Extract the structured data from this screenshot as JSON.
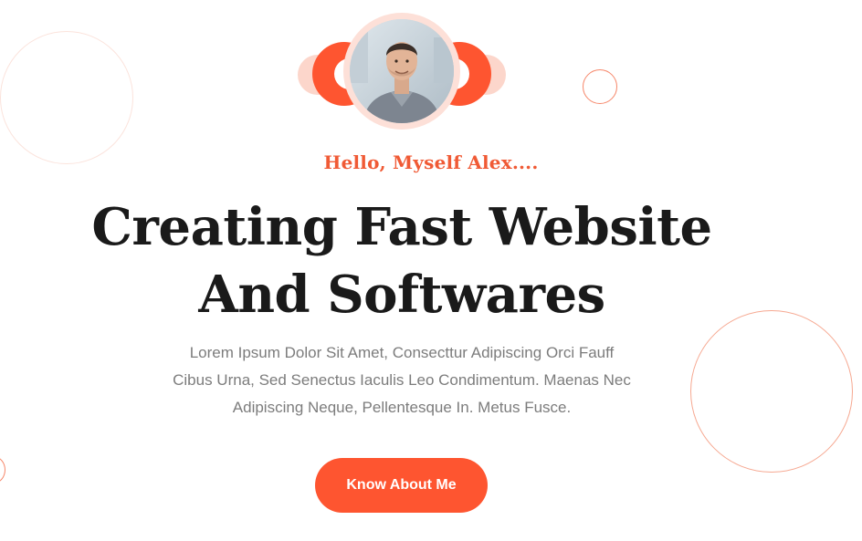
{
  "hero": {
    "greeting": "Hello, Myself Alex....",
    "headline_line1": "Creating Fast Website",
    "headline_line2": "And Softwares",
    "description_line1": "Lorem Ipsum Dolor Sit Amet, Consecttur Adipiscing Orci Fauff",
    "description_line2": "Cibus Urna, Sed Senectus Iaculis Leo Condimentum. Maenas Nec",
    "description_line3": "Adipiscing Neque, Pellentesque In. Metus Fusce.",
    "cta_label": "Know About Me"
  },
  "colors": {
    "accent": "#fe5530",
    "accent_light": "#fcd6cb",
    "heading": "#1a1a1a",
    "body_text": "#7c7c7c"
  },
  "icons": {
    "avatar": "profile-photo"
  }
}
